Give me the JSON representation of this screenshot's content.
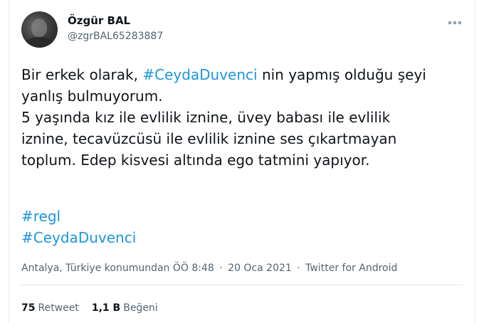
{
  "author": {
    "name": "Özgür BAL",
    "handle": "@zgrBAL65283887"
  },
  "tweet": {
    "line1_pre": "Bir erkek olarak, ",
    "line1_hashtag": "#CeydaDuvenci",
    "line1_post": " nin yapmış olduğu şeyi",
    "line2": "yanlış bulmuyorum.",
    "line3": "5 yaşında kız ile evlilik iznine, üvey babası ile evlilik",
    "line4": "iznine, tecavüzcüsü ile evlilik iznine ses çıkartmayan",
    "line5": "toplum. Edep kisvesi altında ego tatmini yapıyor.",
    "hashtags": [
      "#regl",
      "#CeydaDuvenci"
    ]
  },
  "meta": {
    "location": "Antalya, Türkiye konumundan",
    "time": "ÖÖ 8:48",
    "date": "20 Oca 2021",
    "source": "Twitter for Android",
    "separator": "·"
  },
  "stats": {
    "retweets_count": "75",
    "retweets_label": "Retweet",
    "likes_count": "1,1 B",
    "likes_label": "Beğeni"
  },
  "icons": {
    "more": "more-options-icon"
  },
  "colors": {
    "hashtag": "#1b95e0",
    "secondary_text": "#536471",
    "divider": "#e1e8ed"
  }
}
